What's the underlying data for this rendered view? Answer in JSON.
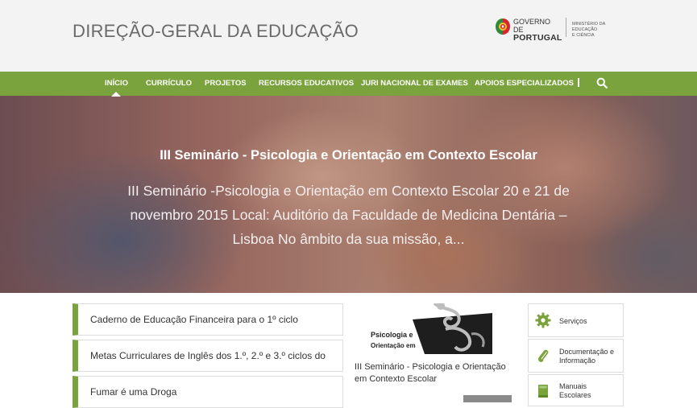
{
  "header": {
    "site_title": "DIREÇÃO-GERAL DA EDUCAÇÃO",
    "gov_line1": "GOVERNO DE",
    "gov_line2": "PORTUGAL",
    "ministry_line1": "MINISTÉRIO DA EDUCAÇÃO",
    "ministry_line2": "E CIÊNCIA"
  },
  "nav": {
    "items": [
      "Início",
      "Currículo",
      "Projetos",
      "Recursos Educativos",
      "Juri Nacional de Exames",
      "Apoios Especializados"
    ],
    "active_index": 0,
    "search_icon": "search-icon"
  },
  "hero": {
    "title": "III Seminário - Psicologia e Orientação em Contexto Escolar",
    "text": "III Seminário -Psicologia e Orientação em Contexto Escolar 20 e 21 de novembro 2015 Local: Auditório da Faculdade de Medicina Dentária – Lisboa   No âmbito da sua missão, a..."
  },
  "list": [
    "Caderno de Educação Financeira para o 1º ciclo",
    "Metas Curriculares de Inglês dos 1.º, 2.º e 3.º ciclos do",
    "Fumar é uma Droga"
  ],
  "news": {
    "image_line1": "Psicologia e",
    "image_line2": "Orientação em",
    "caption": "III Seminário - Psicologia e Orientação em Contexto Escolar"
  },
  "sidebar": {
    "items": [
      {
        "label": "Serviços",
        "icon": "gear-icon"
      },
      {
        "label": "Documentação e Informação",
        "icon": "paperclip-icon"
      },
      {
        "label": "Manuais Escolares",
        "icon": "book-icon"
      }
    ]
  },
  "colors": {
    "accent": "#7ba33d",
    "header_bg": "#f3f3f3",
    "text": "#333333"
  }
}
